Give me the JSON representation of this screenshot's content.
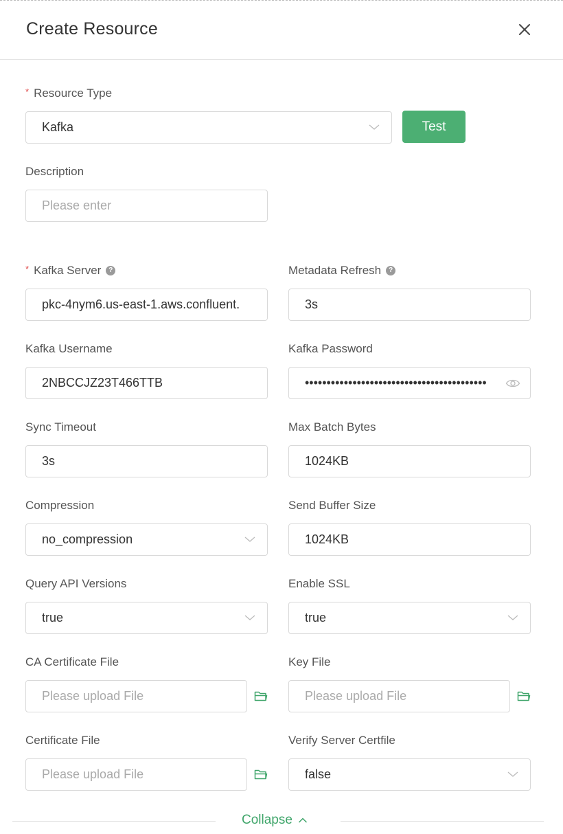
{
  "dialog": {
    "title": "Create Resource"
  },
  "resource_type": {
    "required_mark": "*",
    "label": "Resource Type",
    "value": "Kafka",
    "test_label": "Test"
  },
  "description": {
    "label": "Description",
    "placeholder": "Please enter"
  },
  "kafka_server": {
    "required_mark": "*",
    "label": "Kafka Server",
    "help_icon": "?",
    "value": "pkc-4nym6.us-east-1.aws.confluent."
  },
  "metadata_refresh": {
    "label": "Metadata Refresh",
    "help_icon": "?",
    "value": "3s"
  },
  "kafka_username": {
    "label": "Kafka Username",
    "value": "2NBCCJZ23T466TTB"
  },
  "kafka_password": {
    "label": "Kafka Password",
    "masked_value": "••••••••••••••••••••••••••••••••••••••••••"
  },
  "sync_timeout": {
    "label": "Sync Timeout",
    "value": "3s"
  },
  "max_batch_bytes": {
    "label": "Max Batch Bytes",
    "value": "1024KB"
  },
  "compression": {
    "label": "Compression",
    "value": "no_compression"
  },
  "send_buffer_size": {
    "label": "Send Buffer Size",
    "value": "1024KB"
  },
  "query_api_versions": {
    "label": "Query API Versions",
    "value": "true"
  },
  "enable_ssl": {
    "label": "Enable SSL",
    "value": "true"
  },
  "ca_certificate_file": {
    "label": "CA Certificate File",
    "placeholder": "Please upload File"
  },
  "key_file": {
    "label": "Key File",
    "placeholder": "Please upload File"
  },
  "certificate_file": {
    "label": "Certificate File",
    "placeholder": "Please upload File"
  },
  "verify_server_certfile": {
    "label": "Verify Server Certfile",
    "value": "false"
  },
  "footer": {
    "collapse_label": "Collapse"
  },
  "colors": {
    "accent": "#4caf73",
    "link": "#3fa56a",
    "required": "#e04a4a",
    "border": "#d9d9d9"
  },
  "icons": [
    "close-icon",
    "chevron-down-icon",
    "help-icon",
    "eye-icon",
    "folder-icon",
    "chevron-up-icon"
  ]
}
